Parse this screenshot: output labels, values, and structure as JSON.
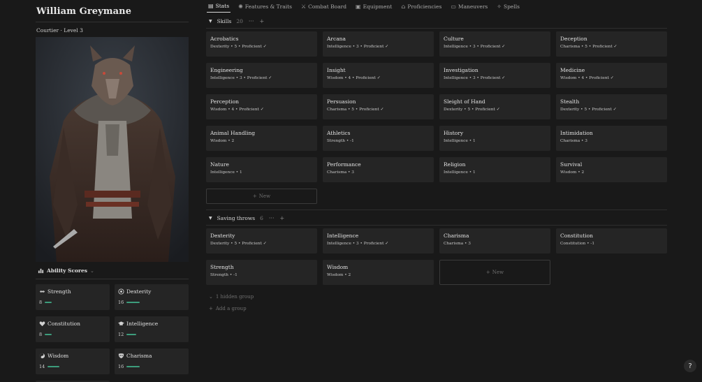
{
  "character": {
    "name": "William Greymane",
    "subtitle": "Courtier · Level 3"
  },
  "ability_section": {
    "title": "Ability Scores"
  },
  "abilities": [
    {
      "name": "Strength",
      "score": "8",
      "bar_fraction": 0.4,
      "icon": "arm-icon"
    },
    {
      "name": "Dexterity",
      "score": "16",
      "bar_fraction": 0.8,
      "icon": "target-icon"
    },
    {
      "name": "Constitution",
      "score": "8",
      "bar_fraction": 0.4,
      "icon": "heart-icon"
    },
    {
      "name": "Intelligence",
      "score": "12",
      "bar_fraction": 0.6,
      "icon": "graduation-cap-icon"
    },
    {
      "name": "Wisdom",
      "score": "14",
      "bar_fraction": 0.7,
      "icon": "yin-yang-icon"
    },
    {
      "name": "Charisma",
      "score": "16",
      "bar_fraction": 0.8,
      "icon": "mask-icon"
    }
  ],
  "tabs": [
    {
      "label": "Stats",
      "icon": "table-icon",
      "active": true
    },
    {
      "label": "Features & Traits",
      "icon": "sun-icon",
      "active": false
    },
    {
      "label": "Combat Board",
      "icon": "sword-icon",
      "active": false
    },
    {
      "label": "Equipment",
      "icon": "backpack-icon",
      "active": false
    },
    {
      "label": "Proficiencies",
      "icon": "school-icon",
      "active": false
    },
    {
      "label": "Maneuvers",
      "icon": "scroll-icon",
      "active": false
    },
    {
      "label": "Spells",
      "icon": "sparkle-icon",
      "active": false
    }
  ],
  "skills_group": {
    "title": "Skills",
    "count": "20",
    "new_label": "New",
    "items": [
      {
        "name": "Acrobatics",
        "detail": "Dexterity • 5 • Proficient ✓"
      },
      {
        "name": "Arcana",
        "detail": "Intelligence • 3 • Proficient ✓"
      },
      {
        "name": "Culture",
        "detail": "Intelligence • 3 • Proficient ✓"
      },
      {
        "name": "Deception",
        "detail": "Charisma • 5 • Proficient ✓"
      },
      {
        "name": "Engineering",
        "detail": "Intelligence • 3 • Proficient ✓"
      },
      {
        "name": "Insight",
        "detail": "Wisdom • 4 • Proficient ✓"
      },
      {
        "name": "Investigation",
        "detail": "Intelligence • 3 • Proficient ✓"
      },
      {
        "name": "Medicine",
        "detail": "Wisdom • 4 • Proficient ✓"
      },
      {
        "name": "Perception",
        "detail": "Wisdom • 4 • Proficient ✓"
      },
      {
        "name": "Persuasion",
        "detail": "Charisma • 5 • Proficient ✓"
      },
      {
        "name": "Sleight of Hand",
        "detail": "Dexterity • 5 • Proficient ✓"
      },
      {
        "name": "Stealth",
        "detail": "Dexterity • 5 • Proficient ✓"
      },
      {
        "name": "Animal Handling",
        "detail": "Wisdom • 2"
      },
      {
        "name": "Athletics",
        "detail": "Strength • -1"
      },
      {
        "name": "History",
        "detail": "Intelligence • 1"
      },
      {
        "name": "Intimidation",
        "detail": "Charisma • 3"
      },
      {
        "name": "Nature",
        "detail": "Intelligence • 1"
      },
      {
        "name": "Performance",
        "detail": "Charisma • 3"
      },
      {
        "name": "Religion",
        "detail": "Intelligence • 1"
      },
      {
        "name": "Survival",
        "detail": "Wisdom • 2"
      }
    ]
  },
  "saves_group": {
    "title": "Saving throws",
    "count": "6",
    "new_label": "New",
    "items": [
      {
        "name": "Dexterity",
        "detail": "Dexterity • 5 • Proficient ✓"
      },
      {
        "name": "Intelligence",
        "detail": "Intelligence • 3 • Proficient ✓"
      },
      {
        "name": "Charisma",
        "detail": "Charisma • 3"
      },
      {
        "name": "Constitution",
        "detail": "Constitution • -1"
      },
      {
        "name": "Strength",
        "detail": "Strength • -1"
      },
      {
        "name": "Wisdom",
        "detail": "Wisdom • 2"
      }
    ]
  },
  "hidden_group_label": "1 hidden group",
  "add_group_label": "Add a group",
  "help_label": "?"
}
